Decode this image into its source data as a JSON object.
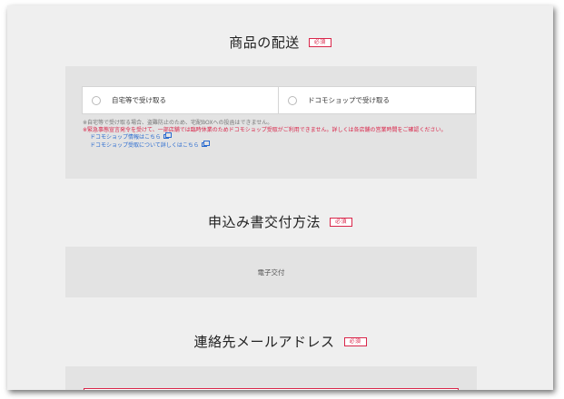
{
  "delivery": {
    "title": "商品の配送",
    "required_badge": "必須",
    "options": [
      {
        "label": "自宅等で受け取る"
      },
      {
        "label": "ドコモショップで受け取る"
      }
    ],
    "notes": {
      "gray": "※自宅等で受け取る場合、盗難防止のため、宅配BOXへの投函はできません。",
      "red": "※緊急事態宣言発令を受けて、一部店舗では臨時休業のためドコモショップ受取がご利用できません。詳しくは各店舗の営業時間をご確認ください。",
      "links": [
        {
          "label": "ドコモショップ情報はこちら"
        },
        {
          "label": "ドコモショップ受取について詳しくはこちら"
        }
      ]
    }
  },
  "application_method": {
    "title": "申込み書交付方法",
    "required_badge": "必須",
    "value": "電子交付"
  },
  "email": {
    "title": "連絡先メールアドレス",
    "required_badge": "必須"
  },
  "colors": {
    "accent_red": "#d9264a",
    "link_blue": "#2a6bd0",
    "panel_gray": "#e3e3e3",
    "page_gray": "#efefef"
  }
}
